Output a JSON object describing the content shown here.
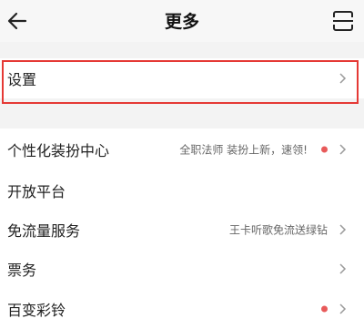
{
  "header": {
    "title": "更多"
  },
  "settings": {
    "label": "设置"
  },
  "items": [
    {
      "label": "个性化装扮中心",
      "detail": "全职法师 装扮上新，速领!",
      "has_dot": true
    },
    {
      "label": "开放平台",
      "detail": "",
      "has_dot": false
    },
    {
      "label": "免流量服务",
      "detail": "王卡听歌免流送绿钻",
      "has_dot": false
    },
    {
      "label": "票务",
      "detail": "",
      "has_dot": false
    },
    {
      "label": "百变彩铃",
      "detail": "",
      "has_dot": true
    }
  ],
  "colors": {
    "highlight": "#e53935",
    "dot": "#e85a5a",
    "background": "#f3f3f3"
  }
}
